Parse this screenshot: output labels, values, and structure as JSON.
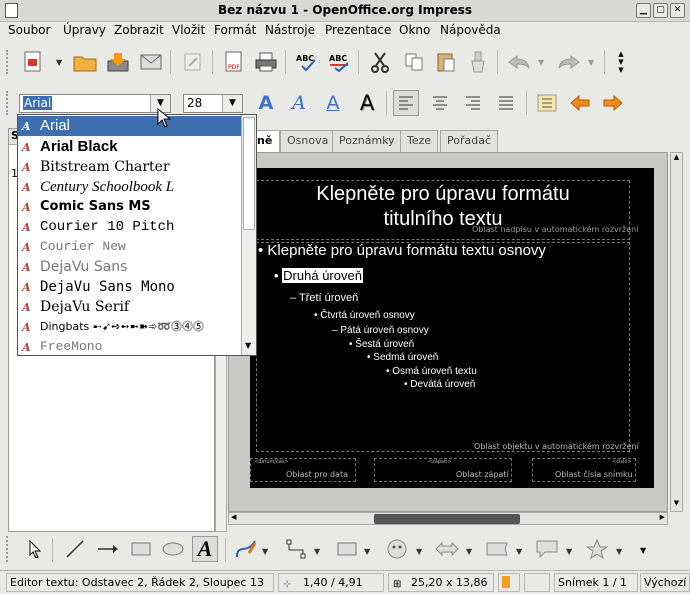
{
  "window": {
    "title": "Bez názvu 1 - OpenOffice.org Impress"
  },
  "menu": [
    "Soubor",
    "Úpravy",
    "Zobrazit",
    "Vložit",
    "Formát",
    "Nástroje",
    "Prezentace",
    "Okno",
    "Nápověda"
  ],
  "formatting": {
    "font_name": "Arial",
    "font_size": "28"
  },
  "font_list": [
    "Arial",
    "Arial Black",
    "Bitstream Charter",
    "Century Schoolbook L",
    "Comic Sans MS",
    "Courier 10 Pitch",
    "Courier New",
    "DejaVu Sans",
    "DejaVu Sans Mono",
    "DejaVu Serif",
    "Dingbats",
    "FreeMono"
  ],
  "dingbats_sample": "➸➹➺➻➼➽➾➿⓷⓸⓹",
  "left_pane": {
    "header": "S",
    "slide_number": "1"
  },
  "tabs": [
    "Normální",
    "Osnova",
    "Poznámky",
    "Teze",
    "Pořadač snímků"
  ],
  "tab_visible_first": "ně",
  "slide": {
    "title_line1": "Klepněte pro úpravu formátu",
    "title_line2": "titulního textu",
    "title_placeholder_label": "Oblast nadpisu v automatickém rozvržení",
    "outline": [
      "Klepněte pro úpravu formátu textu osnovy",
      "Druhá úroveň",
      "Třetí úroveň",
      "Čtvrtá úroveň osnovy",
      "Pátá úroveň osnovy",
      "Šestá úroveň",
      "Sedmá úroveň",
      "Osmá úroveň textu",
      "Devátá úroveň"
    ],
    "object_placeholder_label": "Oblast objektu v automatickém rozvržení",
    "footer_labels": [
      "Oblast pro data",
      "Oblast zápatí",
      "Oblast čísla snímku"
    ],
    "footer_fields": [
      "<datum/čas>",
      "<zápatí>",
      "<číslo>"
    ]
  },
  "status": {
    "text_edit": "Editor textu: Odstavec 2, Řádek 2, Sloupec 13",
    "position": "1,40 / 4,91",
    "size": "25,20 x 13,86",
    "slide": "Snímek 1 / 1",
    "layout": "Výchozí"
  },
  "colors": {
    "selection": "#3d6eb0",
    "slide_bg": "#000000",
    "arrow_orange": "#f08a1c",
    "font_icon_red": "#c0392b"
  }
}
